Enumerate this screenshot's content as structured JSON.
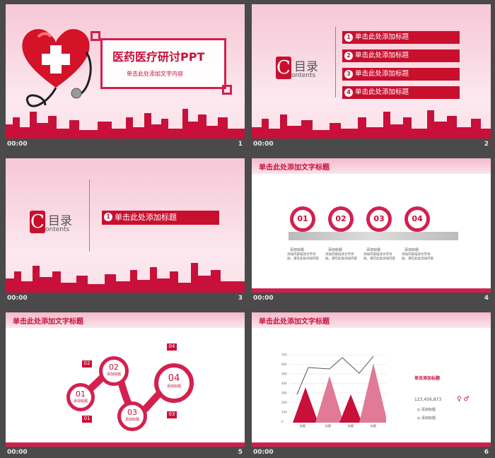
{
  "slides": [
    {
      "number": "1",
      "time": "00:00",
      "title": "医药医疗研讨PPT",
      "subtitle": "单击此处添加文字内容"
    },
    {
      "number": "2",
      "time": "00:00",
      "toc_title": "目录",
      "toc_sub": "ontents",
      "toc_c": "C",
      "items": [
        {
          "num": "1",
          "label": "单击此处添加标题"
        },
        {
          "num": "2",
          "label": "单击此处添加标题"
        },
        {
          "num": "3",
          "label": "单击此处添加标题"
        },
        {
          "num": "4",
          "label": "单击此处添加标题"
        }
      ]
    },
    {
      "number": "3",
      "time": "00:00",
      "toc_title": "目录",
      "toc_sub": "ontents",
      "toc_c": "C",
      "item": {
        "num": "1",
        "label": "单击此处添加标题"
      }
    },
    {
      "number": "4",
      "time": "00:00",
      "header": "单击此处添加文字标题",
      "steps": [
        "01",
        "02",
        "03",
        "04"
      ],
      "step_label": "添加标题",
      "step_text": "添加内容描述文字添加，请在此处添加内容"
    },
    {
      "number": "5",
      "time": "00:00",
      "header": "单击此处添加文字标题",
      "circles": [
        "01",
        "02",
        "03",
        "04"
      ],
      "circle_label": "添加标题",
      "tags": [
        "02",
        "04",
        "01",
        "03"
      ]
    },
    {
      "number": "6",
      "time": "00:00",
      "header": "单击此处添加文字标题",
      "side_title": "单击添加标题",
      "value": "123,456,873",
      "legend": [
        "添加标题",
        "添加标题"
      ],
      "chart_data": {
        "type": "area",
        "categories": [
          "标题",
          "标题",
          "标题",
          "标题"
        ],
        "yticks": [
          "700",
          "600",
          "500",
          "400",
          "300",
          "200",
          "100",
          "0"
        ]
      }
    }
  ]
}
